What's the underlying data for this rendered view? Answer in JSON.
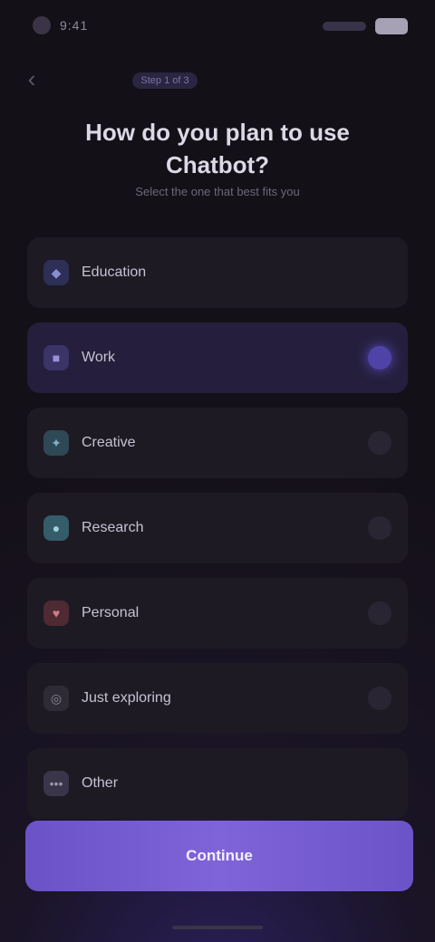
{
  "status_bar": {
    "time": "9:41"
  },
  "header": {
    "back_icon": "back-chevron-icon",
    "step_label": "Step 1 of 3",
    "title": "How do you plan to use Chatbot?",
    "subtitle": "Select the one that best fits you"
  },
  "options": [
    {
      "label": "Education",
      "icon": "graduation-icon",
      "color": "#3a3f7a",
      "selected": false
    },
    {
      "label": "Work",
      "icon": "briefcase-icon",
      "color": "#4a4370",
      "selected": true
    },
    {
      "label": "Creative",
      "icon": "sparkles-icon",
      "color": "#3c5e6e",
      "selected": false
    },
    {
      "label": "Research",
      "icon": "search-icon",
      "color": "#4c7886",
      "selected": false
    },
    {
      "label": "Personal",
      "icon": "heart-icon",
      "color": "#6b3a44",
      "selected": false
    },
    {
      "label": "Just exploring",
      "icon": "compass-icon",
      "color": "#3d3846",
      "selected": false
    },
    {
      "label": "Other",
      "icon": "more-icon",
      "color": "#454056",
      "selected": false
    }
  ],
  "primary_button": {
    "label": "Continue"
  },
  "colors": {
    "accent": "#7a5fd6",
    "background": "#141018"
  }
}
